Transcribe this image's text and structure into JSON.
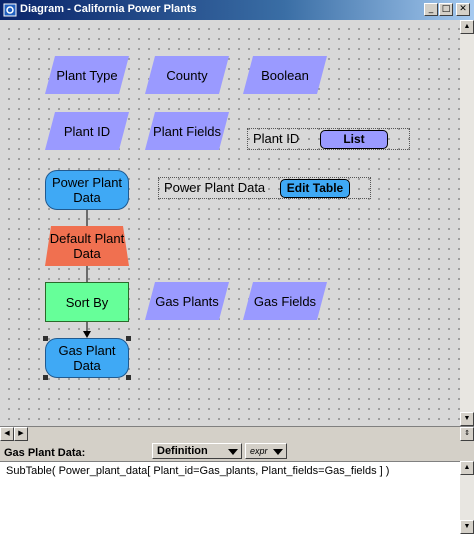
{
  "window": {
    "title": "Diagram - California Power Plants"
  },
  "diagram": {
    "nodes": {
      "plant_type": "Plant Type",
      "county": "County",
      "boolean": "Boolean",
      "plant_id": "Plant ID",
      "plant_fields": "Plant Fields",
      "power_plant_data": "Power Plant Data",
      "default_plant_data": "Default Plant Data",
      "sort_by": "Sort By",
      "gas_plants": "Gas Plants",
      "gas_fields": "Gas Fields",
      "gas_plant_data": "Gas Plant Data"
    },
    "plant_id_input": {
      "label": "Plant ID",
      "button": "List"
    },
    "power_plant_input": {
      "label": "Power Plant Data",
      "button": "Edit Table"
    }
  },
  "bottom_pane": {
    "label": "Gas Plant Data:",
    "view_select": "Definition",
    "expr_select": "expr",
    "definition": "SubTable( Power_plant_data[ Plant_id=Gas_plants, Plant_fields=Gas_fields ] )"
  },
  "colors": {
    "variable": "#9a9aff",
    "object": "#3fa9f5",
    "decision": "#f07050",
    "index": "#66ff99"
  }
}
